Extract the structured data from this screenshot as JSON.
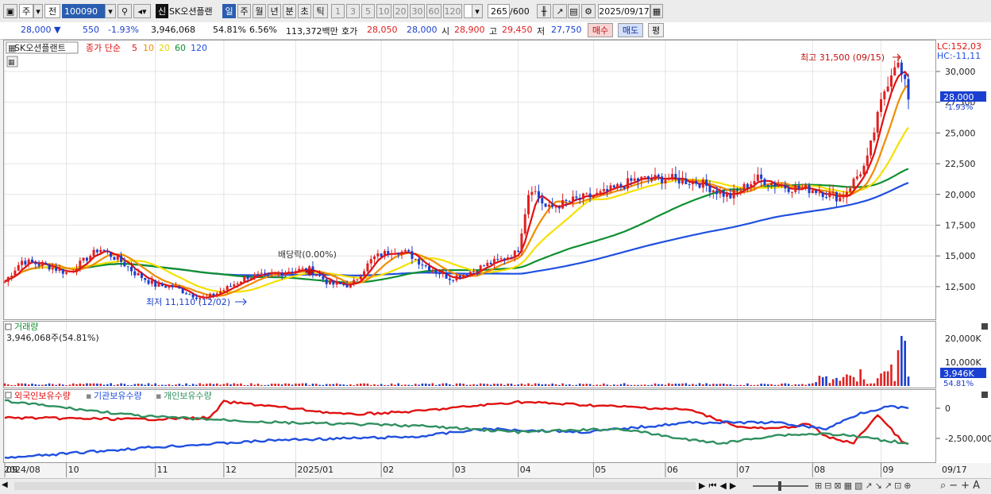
{
  "toolbar": {
    "period_type": "주",
    "code_label": "전",
    "code": "100090",
    "badge": "신",
    "stock_name": "SK오션플랜",
    "periods": [
      "일",
      "주",
      "월",
      "년",
      "분",
      "초",
      "틱"
    ],
    "active_period": "일",
    "intervals": [
      "1",
      "3",
      "5",
      "10",
      "20",
      "30",
      "60",
      "120"
    ],
    "count": "265",
    "count_max": "/600",
    "date": "2025/09/17"
  },
  "quote": {
    "price": "28,000 ▼",
    "change": "550",
    "change_pct": "-1.93%",
    "volume": "3,946,068",
    "vol_ratio": "54.81%",
    "turnover": "6.56%",
    "amount": "113,372백만",
    "ask_label": "호가",
    "ask": "28,050",
    "bid": "28,000",
    "open_label": "시",
    "open": "28,900",
    "high_label": "고",
    "high": "29,450",
    "low_label": "저",
    "low": "27,750",
    "buy_label": "매수",
    "sell_label": "매도",
    "eval_label": "평"
  },
  "chart": {
    "name_tag": "SK오션플랜트",
    "indicator_label": "종가 단순",
    "ma_periods": [
      "5",
      "10",
      "20",
      "60",
      "120"
    ],
    "lc": "LC:152,03",
    "hc": "HC:-11,11",
    "price_ticks": [
      "30,000",
      "27,500",
      "25,000",
      "22,500",
      "20,000",
      "17,500",
      "15,000",
      "12,500"
    ],
    "last_price": "28,000",
    "last_pct": "-1.93%",
    "high_note": "최고 31,500 (09/15)",
    "low_note": "최저 11,110 (12/02)",
    "dividend_note": "배당락(0.00%)",
    "volume_title": "거래량",
    "volume_value": "3,946,068주(54.81%)",
    "volume_ticks": [
      "20,000K",
      "10,000K"
    ],
    "volume_last": "3,946K",
    "volume_last_pct": "54.81%",
    "holdings_labels": [
      "외국인보유수량",
      "기관보유수량",
      "개인보유수량"
    ],
    "holdings_ticks": [
      "0",
      "-2,500,000"
    ],
    "x_labels": [
      "2024/08",
      "09",
      "10",
      "11",
      "12",
      "2025/01",
      "02",
      "03",
      "04",
      "05",
      "06",
      "07",
      "08",
      "09"
    ],
    "x_end_label": "09/17"
  },
  "colors": {
    "up": "#e02020",
    "down": "#1a3fd0",
    "ma5": "#e01010",
    "ma10": "#f08c00",
    "ma20": "#f5e000",
    "ma60": "#109030",
    "ma120": "#2050e0",
    "foreign": "#e01010",
    "institution": "#2050e0",
    "individual": "#309060"
  }
}
